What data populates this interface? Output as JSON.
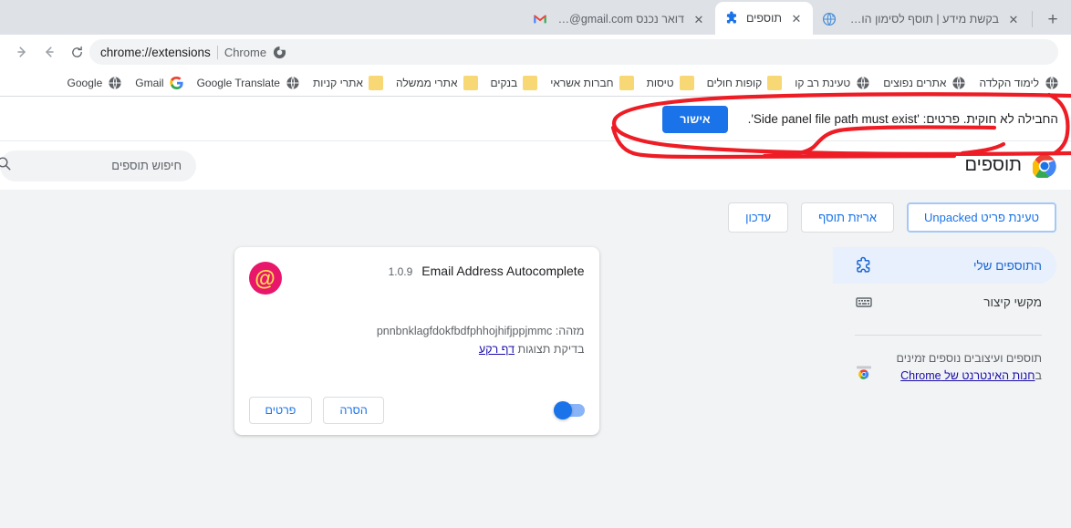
{
  "browser": {
    "tabs": [
      {
        "title": "דואר נכנס Gmail - o@gmail.com",
        "icon": "gmail-icon",
        "active": false
      },
      {
        "title": "תוספים",
        "icon": "extensions-puzzle-icon",
        "active": true
      },
      {
        "title": "בקשת מידע | תוסף לסימון הודעה",
        "icon": "generic-site-icon",
        "active": false
      }
    ],
    "new_tab_label": "+",
    "close_label": "✕",
    "nav": {
      "forward_label": "→",
      "back_label": "←",
      "reload_label": "⟲"
    },
    "omnibox": {
      "url": "chrome://extensions",
      "scheme_chip": "Chrome",
      "divider": "|"
    },
    "bookmarks": [
      {
        "label": "Google",
        "icon": "globe-icon"
      },
      {
        "label": "Gmail",
        "icon": "google-g-icon"
      },
      {
        "label": "Google Translate",
        "icon": "globe-icon"
      },
      {
        "label": "אתרי קניות",
        "icon": "folder-icon"
      },
      {
        "label": "אתרי ממשלה",
        "icon": "folder-icon"
      },
      {
        "label": "בנקים",
        "icon": "folder-icon"
      },
      {
        "label": "חברות אשראי",
        "icon": "folder-icon"
      },
      {
        "label": "טיסות",
        "icon": "folder-icon"
      },
      {
        "label": "קופות חולים",
        "icon": "folder-icon"
      },
      {
        "label": "טעינת רב קו",
        "icon": "globe-icon"
      },
      {
        "label": "אתרים נפוצים",
        "icon": "globe-icon"
      },
      {
        "label": "לימוד הקלדה",
        "icon": "globe-icon"
      }
    ]
  },
  "error_banner": {
    "message": "החבילה לא חוקית. פרטים: 'Side panel file path must exist'.",
    "ok_label": "אישור",
    "accent_color": "#1a73e8"
  },
  "extensions_page": {
    "title": "תוספים",
    "logo_icon": "chrome-logo-icon",
    "search": {
      "placeholder": "חיפוש תוספים",
      "value": "",
      "icon": "search-icon"
    },
    "toolbar_buttons": [
      {
        "label": "טעינת פריט Unpacked",
        "name": "load-unpacked-button",
        "focused": true
      },
      {
        "label": "אריזת תוסף",
        "name": "pack-extension-button",
        "focused": false
      },
      {
        "label": "עדכון",
        "name": "update-button",
        "focused": false
      }
    ],
    "sidebar": {
      "items": [
        {
          "label": "התוספים שלי",
          "icon": "puzzle-icon",
          "selected": true
        },
        {
          "label": "מקשי קיצור",
          "icon": "keyboard-icon",
          "selected": false
        }
      ],
      "footer": {
        "text_before": "תוספים ועיצובים נוספים זמינים ב",
        "link_label": "חנות האינטרנט של Chrome",
        "icon": "chrome-webstore-icon"
      }
    },
    "cards": [
      {
        "name": "Email Address Autocomplete",
        "version": "1.0.9",
        "icon_glyph": "@",
        "icon_bg": "#e8176b",
        "icon_fg": "#ffe24a",
        "id_label": "מזהה:",
        "id_value": "pnnbnklagfdokfbdfphhojhifjppjmmc",
        "inspect_label": "בדיקת תצוגות",
        "inspect_link": "דף רקע",
        "details_label": "פרטים",
        "remove_label": "הסרה",
        "enabled": true
      }
    ]
  },
  "annotations": {
    "color": "#ee1c25",
    "shapes": [
      "ellipse-around-error-banner",
      "underline-stroke",
      "hook-arrow"
    ]
  }
}
